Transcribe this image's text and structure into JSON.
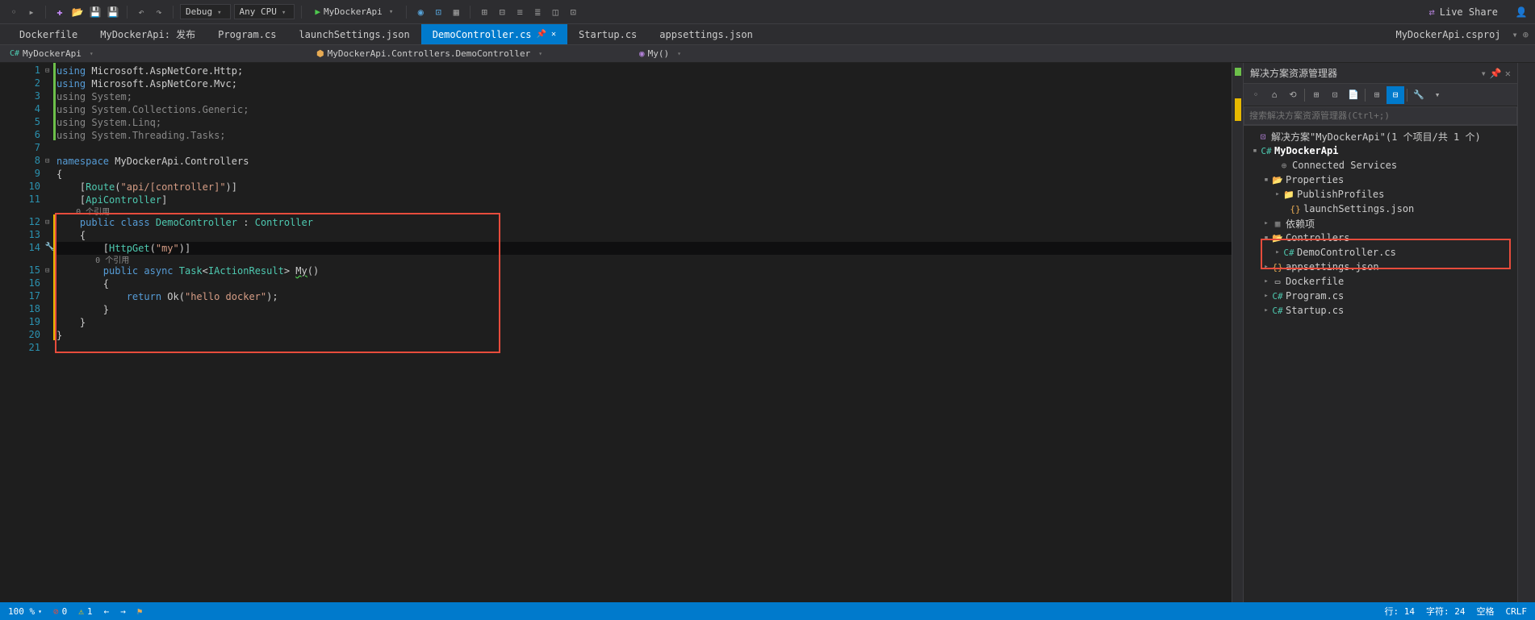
{
  "toolbar": {
    "config": "Debug",
    "platform": "Any CPU",
    "start_target": "MyDockerApi"
  },
  "live_share": "Live Share",
  "tabs": [
    {
      "label": "Dockerfile"
    },
    {
      "label": "MyDockerApi: 发布"
    },
    {
      "label": "Program.cs"
    },
    {
      "label": "launchSettings.json"
    },
    {
      "label": "DemoController.cs",
      "active": true,
      "pinned": true
    },
    {
      "label": "Startup.cs"
    },
    {
      "label": "appsettings.json"
    },
    {
      "label": "MyDockerApi.csproj"
    }
  ],
  "nav": {
    "project": "MyDockerApi",
    "namespace": "MyDockerApi.Controllers.DemoController",
    "member": "My()"
  },
  "code": {
    "ref_label": "0 个引用",
    "lines": {
      "l1": "using Microsoft.AspNetCore.Http;",
      "l2": "using Microsoft.AspNetCore.Mvc;",
      "l3": "using System;",
      "l4": "using System.Collections.Generic;",
      "l5": "using System.Linq;",
      "l6": "using System.Threading.Tasks;",
      "l8": "namespace MyDockerApi.Controllers",
      "l9": "{",
      "l10a": "[Route(\"api/[controller]\")]",
      "l11": "[ApiController]",
      "l12": "public class DemoController : Controller",
      "l13": "{",
      "l14": "[HttpGet(\"my\")]",
      "l15": "public async Task<IActionResult> My()",
      "l16": "{",
      "l17": "return Ok(\"hello docker\");",
      "l18": "}",
      "l19": "}",
      "l20": "}"
    }
  },
  "solution_explorer": {
    "title": "解决方案资源管理器",
    "search_placeholder": "搜索解决方案资源管理器(Ctrl+;)",
    "solution": "解决方案\"MyDockerApi\"(1 个项目/共 1 个)",
    "project": "MyDockerApi",
    "items": {
      "connected_services": "Connected Services",
      "properties": "Properties",
      "publish_profiles": "PublishProfiles",
      "launch_settings": "launchSettings.json",
      "dependencies": "依赖项",
      "controllers": "Controllers",
      "demo_controller": "DemoController.cs",
      "appsettings": "appsettings.json",
      "dockerfile": "Dockerfile",
      "program": "Program.cs",
      "startup": "Startup.cs"
    }
  },
  "status": {
    "zoom": "100 %",
    "errors": "0",
    "warnings": "1",
    "line": "行: 14",
    "col": "字符: 24",
    "spaces": "空格",
    "lineend": "CRLF"
  }
}
